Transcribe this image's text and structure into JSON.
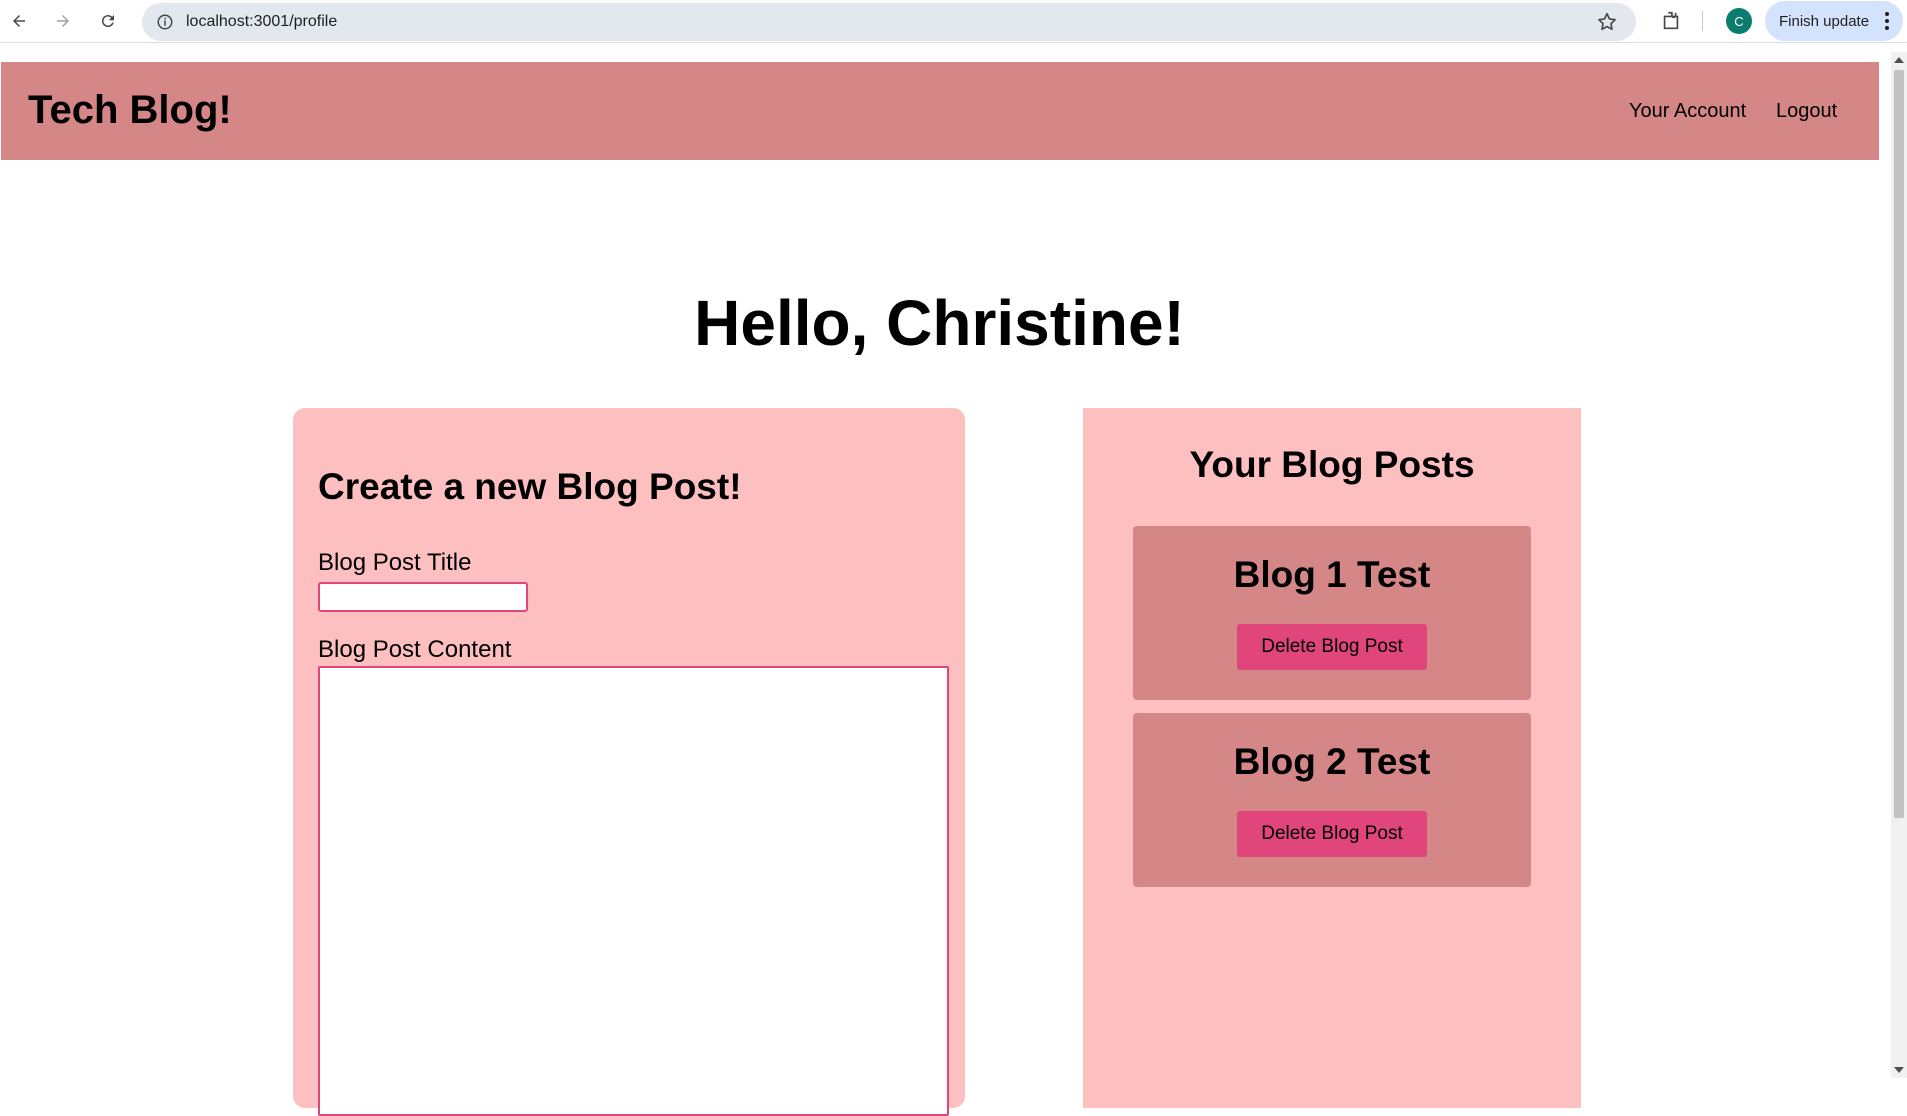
{
  "browser": {
    "url": "localhost:3001/profile",
    "profile_initial": "C",
    "finish_update_label": "Finish update"
  },
  "header": {
    "site_title": "Tech Blog!",
    "nav": {
      "account": "Your Account",
      "logout": "Logout"
    }
  },
  "main": {
    "greeting": "Hello, Christine!",
    "create_post": {
      "heading": "Create a new Blog Post!",
      "title_label": "Blog Post Title",
      "title_value": "",
      "content_label": "Blog Post Content",
      "content_value": ""
    },
    "your_posts": {
      "heading": "Your Blog Posts",
      "posts": [
        {
          "title": "Blog 1 Test",
          "delete_label": "Delete Blog Post"
        },
        {
          "title": "Blog 2 Test",
          "delete_label": "Delete Blog Post"
        }
      ]
    }
  },
  "colors": {
    "header_bg": "#d48786",
    "card_bg": "#fdbfbf",
    "post_bg": "#d48786",
    "accent": "#e0457b"
  }
}
